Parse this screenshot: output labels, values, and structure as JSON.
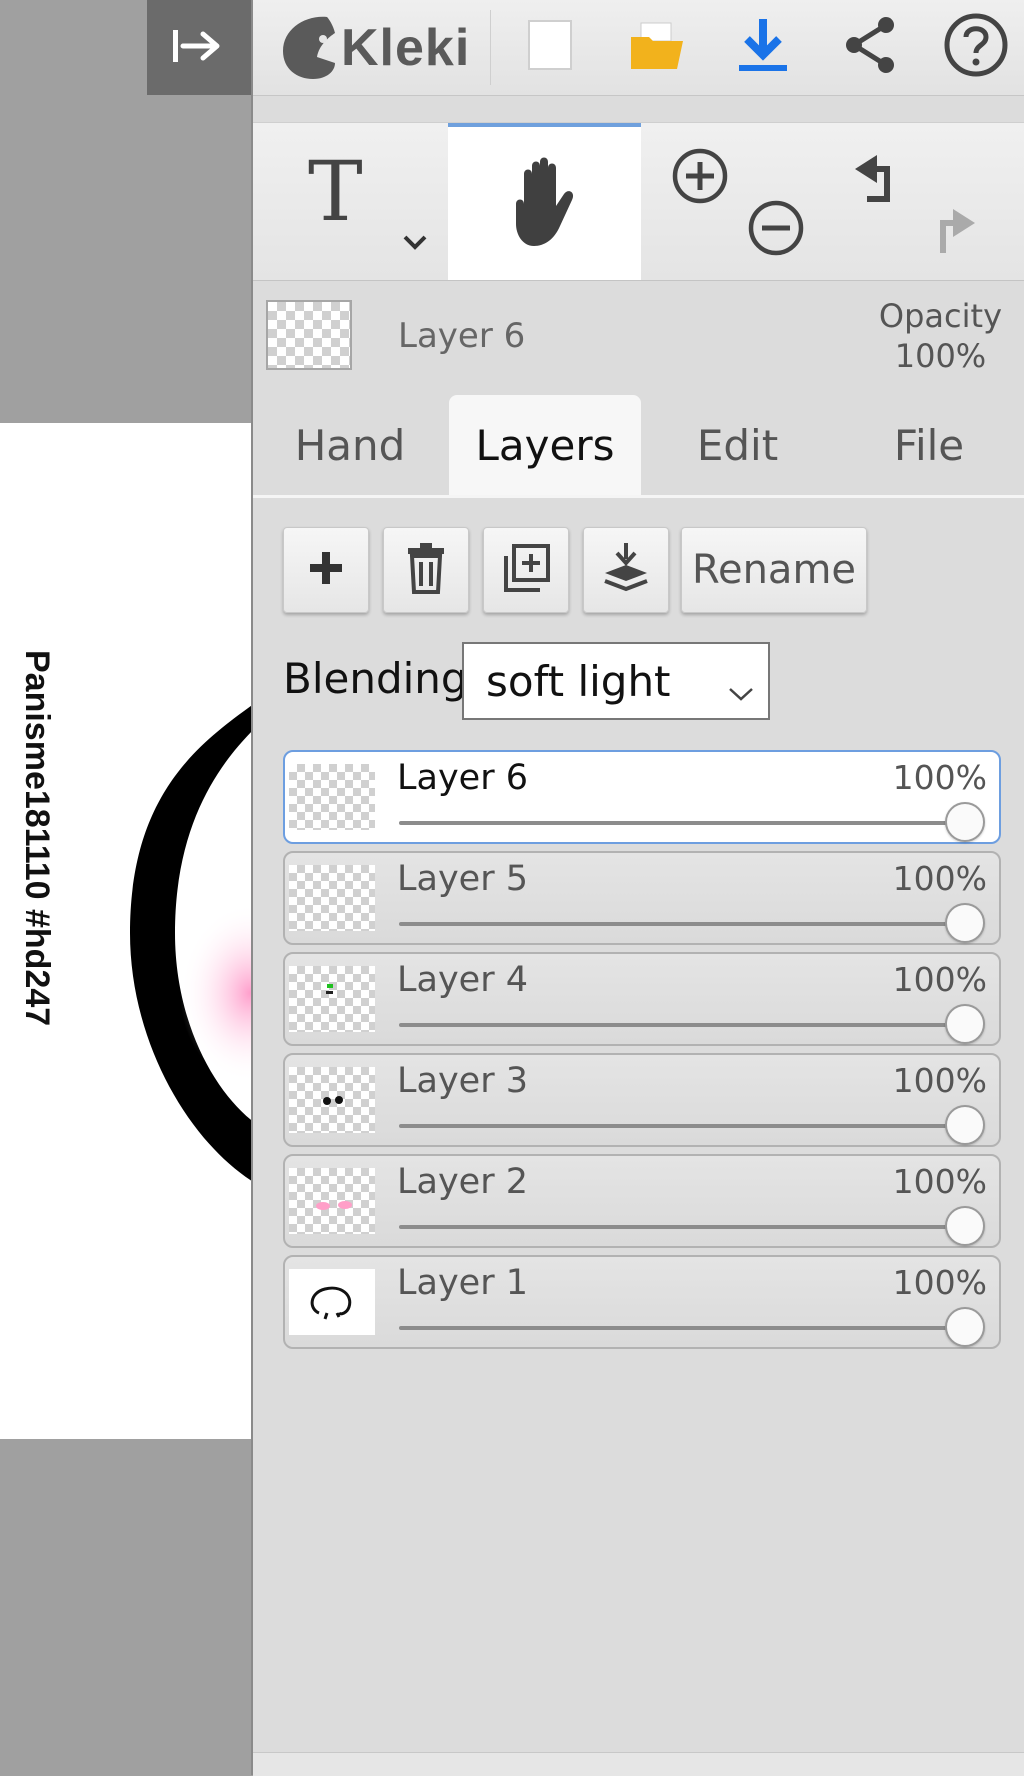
{
  "app": {
    "name": "Kleki"
  },
  "canvas": {
    "watermark": "Panisme181110 #hd247"
  },
  "toolbar": {
    "icons": [
      "sidebar-toggle-icon",
      "new-image-icon",
      "open-folder-icon",
      "download-icon",
      "share-icon",
      "help-icon"
    ]
  },
  "tools": {
    "text_tool": "T",
    "active_tool": "hand"
  },
  "current_layer": {
    "name": "Layer 6",
    "opacity_label": "Opacity",
    "opacity_value": "100%"
  },
  "tabs": [
    {
      "label": "Hand",
      "active": false
    },
    {
      "label": "Layers",
      "active": true
    },
    {
      "label": "Edit",
      "active": false
    },
    {
      "label": "File",
      "active": false
    }
  ],
  "layer_actions": {
    "rename_label": "Rename"
  },
  "blending": {
    "label": "Blending",
    "value": "soft light"
  },
  "layers": [
    {
      "name": "Layer 6",
      "opacity": "100%",
      "level": 1.0,
      "selected": true
    },
    {
      "name": "Layer 5",
      "opacity": "100%",
      "level": 1.0,
      "selected": false
    },
    {
      "name": "Layer 4",
      "opacity": "100%",
      "level": 1.0,
      "selected": false
    },
    {
      "name": "Layer 3",
      "opacity": "100%",
      "level": 1.0,
      "selected": false
    },
    {
      "name": "Layer 2",
      "opacity": "100%",
      "level": 1.0,
      "selected": false
    },
    {
      "name": "Layer 1",
      "opacity": "100%",
      "level": 1.0,
      "selected": false
    }
  ],
  "colors": {
    "accent": "#6fa0dd",
    "download": "#1a73e8",
    "folder": "#f2b21c"
  }
}
